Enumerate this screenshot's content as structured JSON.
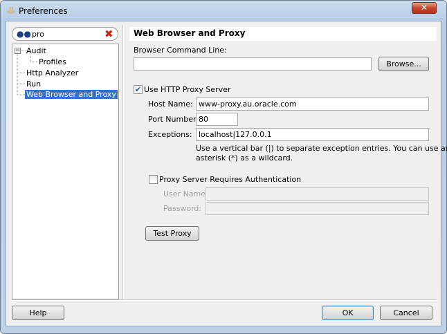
{
  "window": {
    "title": "Preferences",
    "close": "✕"
  },
  "search": {
    "value": "pro",
    "icon": "binoculars-icon",
    "clear": "✖"
  },
  "tree": {
    "expander": "−",
    "items": [
      {
        "label": "Audit"
      },
      {
        "label": "Profiles"
      },
      {
        "label": "Http Analyzer"
      },
      {
        "label": "Run"
      },
      {
        "label": "Web Browser and Proxy"
      }
    ]
  },
  "panel": {
    "title": "Web Browser and Proxy",
    "browser_label": "Browser Command Line:",
    "browser_value": "",
    "browse_button": "Browse...",
    "use_proxy_label": "Use HTTP Proxy Server",
    "use_proxy_checked": true,
    "host_label": "Host Name:",
    "host_value": "www-proxy.au.oracle.com",
    "port_label": "Port Number:",
    "port_value": "80",
    "exceptions_label": "Exceptions:",
    "exceptions_value": "localhost|127.0.0.1",
    "help_line1": "Use a vertical bar (|) to separate exception entries.  You can use an",
    "help_line2": "asterisk (*) as a wildcard.",
    "auth_label": "Proxy Server Requires Authentication",
    "auth_checked": false,
    "user_label": "User Name:",
    "user_value": "",
    "password_label": "Password:",
    "password_value": "",
    "test_button": "Test Proxy"
  },
  "footer": {
    "help": "Help",
    "ok": "OK",
    "cancel": "Cancel"
  }
}
